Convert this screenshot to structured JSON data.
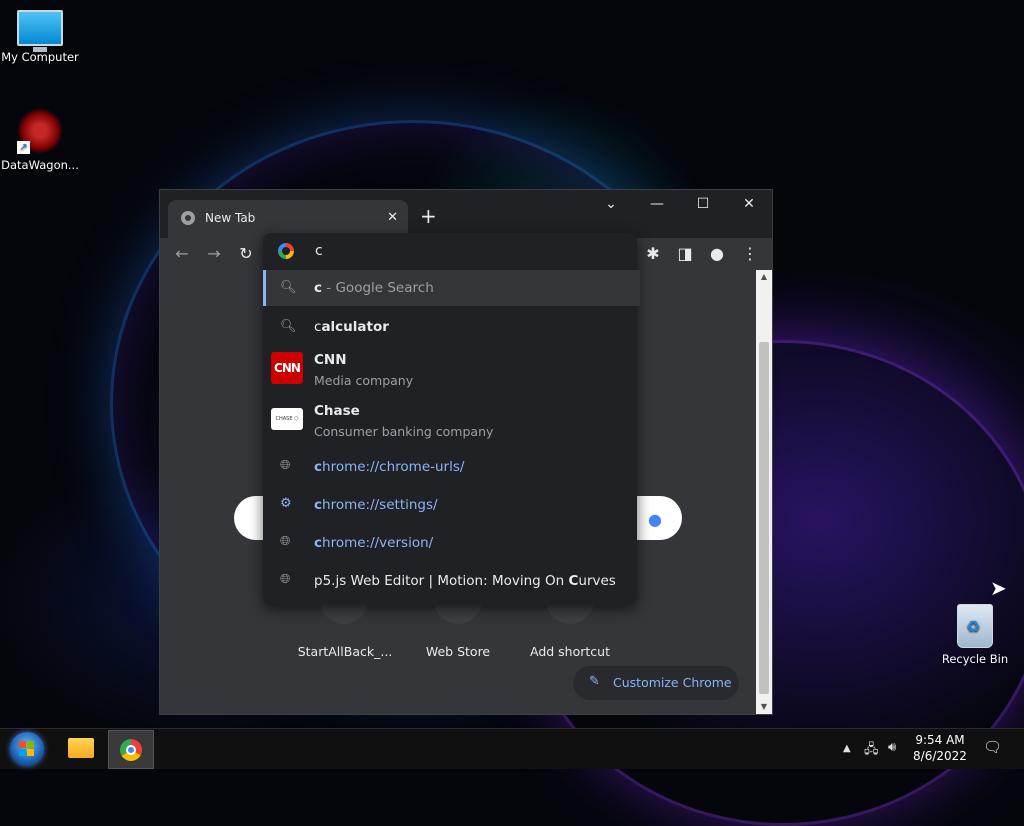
{
  "desktop": {
    "icons": [
      {
        "label": "My Computer"
      },
      {
        "label": "DataWagon..."
      },
      {
        "label": "Recycle Bin"
      }
    ]
  },
  "browser": {
    "tab_title": "New Tab",
    "tab_close": "✕",
    "new_tab": "+",
    "window_controls": {
      "tabsearch": "⌄",
      "minimize": "—",
      "maximize": "☐",
      "close": "✕"
    },
    "toolbar": {
      "back": "←",
      "forward": "→",
      "reload": "↻",
      "extensions": "✱",
      "sidepanel": "◨",
      "profile": "●",
      "menu": "⋮"
    },
    "omnibox": {
      "value": "c"
    },
    "suggestions": [
      {
        "icon": "search-icon",
        "match": "c",
        "rest": "",
        "suffix": " - Google Search"
      },
      {
        "icon": "search-icon",
        "match": "c",
        "rest": "alculator"
      },
      {
        "icon": "cnn-logo",
        "match": "C",
        "rest": "NN",
        "sub": "Media company",
        "logo_text": "CNN"
      },
      {
        "icon": "chase-logo",
        "match": "C",
        "rest": "hase",
        "sub": "Consumer banking company",
        "logo_text": "CHASE ⬡"
      },
      {
        "icon": "globe-icon",
        "match": "c",
        "rest": "hrome://chrome-urls/"
      },
      {
        "icon": "gear-icon",
        "match": "c",
        "rest": "hrome://settings/"
      },
      {
        "icon": "globe-icon",
        "match": "c",
        "rest": "hrome://version/"
      },
      {
        "icon": "globe-icon",
        "pre": "p5.js Web Editor | Motion: Moving On ",
        "match": "C",
        "rest": "urves"
      }
    ],
    "ntp": {
      "shortcuts": [
        {
          "label": "StartAllBack_..."
        },
        {
          "label": "Web Store"
        },
        {
          "label": "Add shortcut"
        }
      ],
      "customize_label": "Customize Chrome"
    }
  },
  "taskbar": {
    "time": "9:54 AM",
    "date": "8/6/2022"
  },
  "colors": {
    "accent": "#8ab4f8",
    "dark_bg": "#202124",
    "toolbar_bg": "#35363a"
  }
}
